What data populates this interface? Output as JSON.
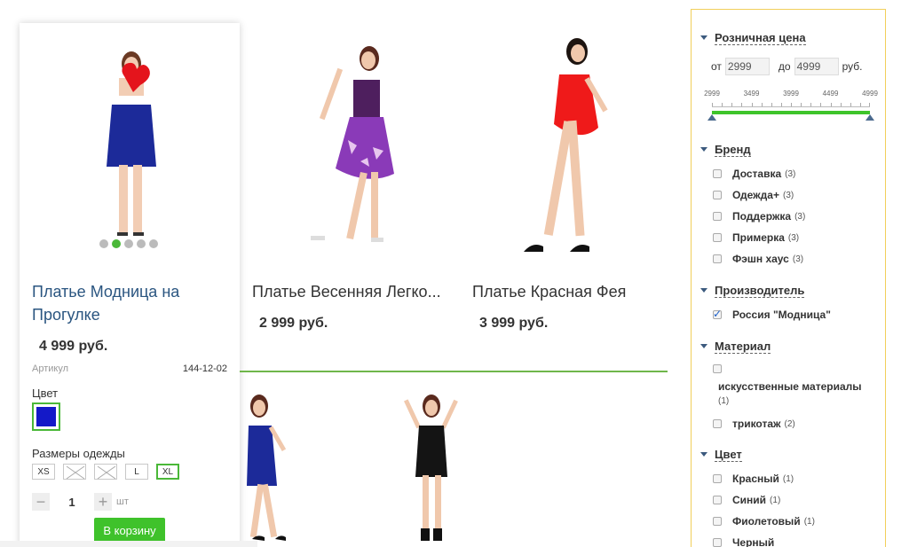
{
  "products": [
    {
      "title": "Платье Модница на Прогулке",
      "price": "4 999 руб."
    },
    {
      "title": "Платье Весенняя Легко...",
      "price": "2 999 руб."
    },
    {
      "title": "Платье Красная Фея",
      "price": "3 999 руб."
    }
  ],
  "card": {
    "article_label": "Артикул",
    "article_value": "144-12-02",
    "color_label": "Цвет",
    "color_swatch": "#1419c8",
    "sizes_label": "Размеры одежды",
    "sizes": [
      {
        "label": "XS",
        "state": "available"
      },
      {
        "label": "",
        "state": "unavailable"
      },
      {
        "label": "",
        "state": "unavailable"
      },
      {
        "label": "L",
        "state": "available"
      },
      {
        "label": "XL",
        "state": "selected"
      }
    ],
    "qty_minus": "−",
    "qty_value": "1",
    "qty_plus": "+",
    "qty_unit": "шт",
    "cart_button": "В корзину",
    "slider_dots": 5,
    "active_dot": 1
  },
  "filters": {
    "price": {
      "title": "Розничная цена",
      "from_label": "от",
      "from_value": "2999",
      "to_label": "до",
      "to_value": "4999",
      "currency": "руб.",
      "scale": [
        "2999",
        "3499",
        "3999",
        "4499",
        "4999"
      ]
    },
    "brand": {
      "title": "Бренд",
      "items": [
        {
          "label": "Доставка",
          "count": "(3)"
        },
        {
          "label": "Одежда+",
          "count": "(3)"
        },
        {
          "label": "Поддержка",
          "count": "(3)"
        },
        {
          "label": "Примерка",
          "count": "(3)"
        },
        {
          "label": "Фэшн хаус",
          "count": "(3)"
        }
      ]
    },
    "manufacturer": {
      "title": "Производитель",
      "items": [
        {
          "label": "Россия \"Модница\"",
          "count": ""
        }
      ]
    },
    "material": {
      "title": "Материал",
      "items": [
        {
          "label": "искусственные материалы",
          "count": "(1)"
        },
        {
          "label": "трикотаж",
          "count": "(2)"
        }
      ]
    },
    "color": {
      "title": "Цвет",
      "items": [
        {
          "label": "Красный",
          "count": "(1)"
        },
        {
          "label": "Синий",
          "count": "(1)"
        },
        {
          "label": "Фиолетовый",
          "count": "(1)"
        },
        {
          "label": "Черный",
          "count": ""
        }
      ]
    }
  },
  "colors": {
    "accent_green": "#3fc22b",
    "link_blue": "#2a5580",
    "sidebar_border": "#f1cf5a"
  }
}
